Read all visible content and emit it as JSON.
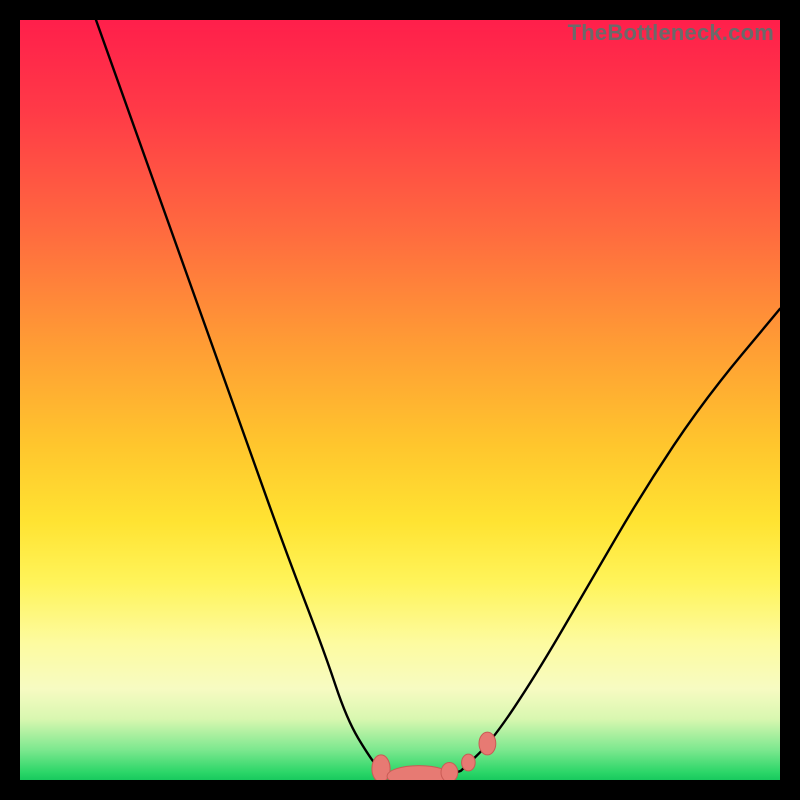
{
  "watermark": "TheBottleneck.com",
  "colors": {
    "frame": "#000000",
    "curve": "#000000",
    "marker_fill": "#e77a73",
    "marker_stroke": "#c95b55"
  },
  "chart_data": {
    "type": "line",
    "title": "",
    "xlabel": "",
    "ylabel": "",
    "xlim": [
      0,
      100
    ],
    "ylim": [
      0,
      100
    ],
    "grid": false,
    "series": [
      {
        "name": "left-curve",
        "x": [
          10,
          15,
          20,
          25,
          30,
          35,
          40,
          43,
          46,
          48
        ],
        "y": [
          100,
          86,
          72,
          58,
          44,
          30,
          17,
          8,
          3,
          0.5
        ]
      },
      {
        "name": "valley",
        "x": [
          48,
          50,
          52,
          54,
          56,
          58
        ],
        "y": [
          0.5,
          0.3,
          0.3,
          0.3,
          0.5,
          1.2
        ]
      },
      {
        "name": "right-curve",
        "x": [
          58,
          62,
          68,
          75,
          82,
          90,
          100
        ],
        "y": [
          1.2,
          5,
          14,
          26,
          38,
          50,
          62
        ]
      }
    ],
    "markers": [
      {
        "name": "valley-cluster-left",
        "x": 47.5,
        "y": 1.5,
        "rx": 1.2,
        "ry": 1.8
      },
      {
        "name": "valley-cluster-bar",
        "x": 52.5,
        "y": 0.5,
        "rx": 4.2,
        "ry": 1.4
      },
      {
        "name": "valley-cluster-mid",
        "x": 56.5,
        "y": 1.0,
        "rx": 1.1,
        "ry": 1.3
      },
      {
        "name": "right-dot-1",
        "x": 59.0,
        "y": 2.3,
        "rx": 0.9,
        "ry": 1.1
      },
      {
        "name": "right-dot-2",
        "x": 61.5,
        "y": 4.8,
        "rx": 1.1,
        "ry": 1.5
      }
    ]
  }
}
